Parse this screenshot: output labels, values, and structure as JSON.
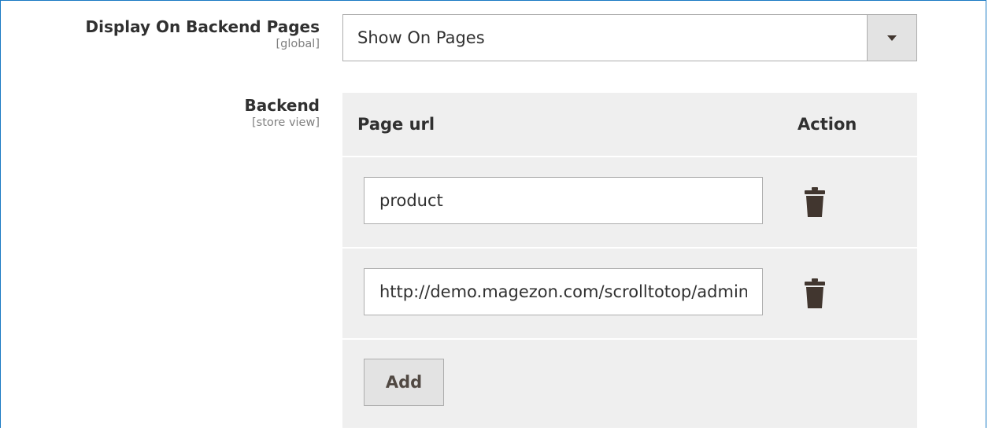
{
  "display_field": {
    "label": "Display On Backend Pages",
    "scope": "[global]",
    "selected_value": "Show On Pages"
  },
  "backend_field": {
    "label": "Backend",
    "scope": "[store view]",
    "columns": {
      "page_url": "Page url",
      "action": "Action"
    },
    "rows": [
      {
        "page_url": "product",
        "action_icon": "trash-icon"
      },
      {
        "page_url": "http://demo.magezon.com/scrolltotop/admin",
        "action_icon": "trash-icon"
      }
    ],
    "add_label": "Add"
  },
  "colors": {
    "frame_border": "#1979c3",
    "grid_background": "#efefef",
    "button_background": "#e3e3e3",
    "text": "#303030",
    "icon": "#41362f"
  }
}
